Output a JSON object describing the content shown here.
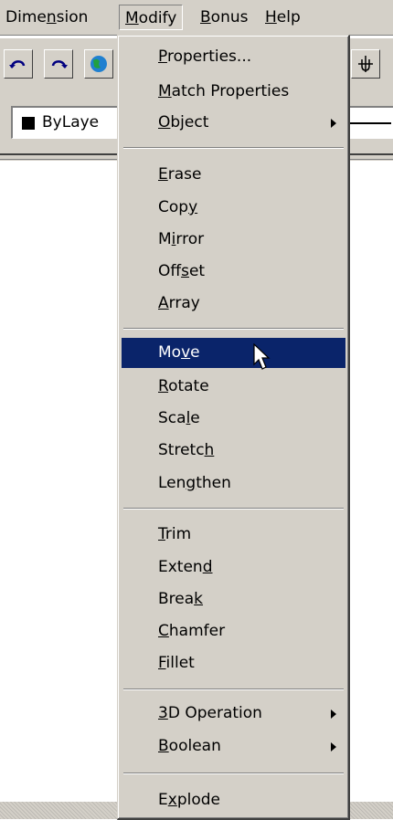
{
  "menubar": {
    "items": [
      {
        "label": "Dimension",
        "mnemonic_pre": "Dime",
        "mnemonic": "n",
        "mnemonic_post": "sion"
      },
      {
        "label": "Modify",
        "mnemonic_pre": "",
        "mnemonic": "M",
        "mnemonic_post": "odify"
      },
      {
        "label": "Bonus",
        "mnemonic_pre": "",
        "mnemonic": "B",
        "mnemonic_post": "onus"
      },
      {
        "label": "Help",
        "mnemonic_pre": "",
        "mnemonic": "H",
        "mnemonic_post": "elp"
      }
    ]
  },
  "toolbar": {
    "buttons": [
      "undo-icon",
      "redo-icon",
      "globe-icon",
      "pan-icon"
    ]
  },
  "properties_bar": {
    "layer_value": "ByLaye",
    "layer_color": "#000000"
  },
  "modify_menu": {
    "items": [
      {
        "pre": "",
        "mn": "P",
        "post": "roperties...",
        "submenu": false
      },
      {
        "pre": "",
        "mn": "M",
        "post": "atch Properties",
        "submenu": false
      },
      {
        "pre": "",
        "mn": "O",
        "post": "bject",
        "submenu": true
      },
      {
        "pre": "",
        "mn": "E",
        "post": "rase",
        "submenu": false
      },
      {
        "pre": "Cop",
        "mn": "y",
        "post": "",
        "submenu": false
      },
      {
        "pre": "M",
        "mn": "i",
        "post": "rror",
        "submenu": false
      },
      {
        "pre": "Off",
        "mn": "s",
        "post": "et",
        "submenu": false
      },
      {
        "pre": "",
        "mn": "A",
        "post": "rray",
        "submenu": false
      },
      {
        "pre": "Mo",
        "mn": "v",
        "post": "e",
        "submenu": false,
        "selected": true
      },
      {
        "pre": "",
        "mn": "R",
        "post": "otate",
        "submenu": false
      },
      {
        "pre": "Sca",
        "mn": "l",
        "post": "e",
        "submenu": false
      },
      {
        "pre": "Stretc",
        "mn": "h",
        "post": "",
        "submenu": false
      },
      {
        "pre": "Len",
        "mn": "g",
        "post": "then",
        "submenu": false
      },
      {
        "pre": "",
        "mn": "T",
        "post": "rim",
        "submenu": false
      },
      {
        "pre": "Exten",
        "mn": "d",
        "post": "",
        "submenu": false
      },
      {
        "pre": "Brea",
        "mn": "k",
        "post": "",
        "submenu": false
      },
      {
        "pre": "",
        "mn": "C",
        "post": "hamfer",
        "submenu": false
      },
      {
        "pre": "",
        "mn": "F",
        "post": "illet",
        "submenu": false
      },
      {
        "pre": "",
        "mn": "3",
        "post": "D Operation",
        "submenu": true
      },
      {
        "pre": "",
        "mn": "B",
        "post": "oolean",
        "submenu": true
      },
      {
        "pre": "E",
        "mn": "x",
        "post": "plode",
        "submenu": false
      }
    ]
  },
  "colors": {
    "face": "#d4d0c8",
    "highlight": "#0a246a",
    "highlight_text": "#ffffff"
  }
}
